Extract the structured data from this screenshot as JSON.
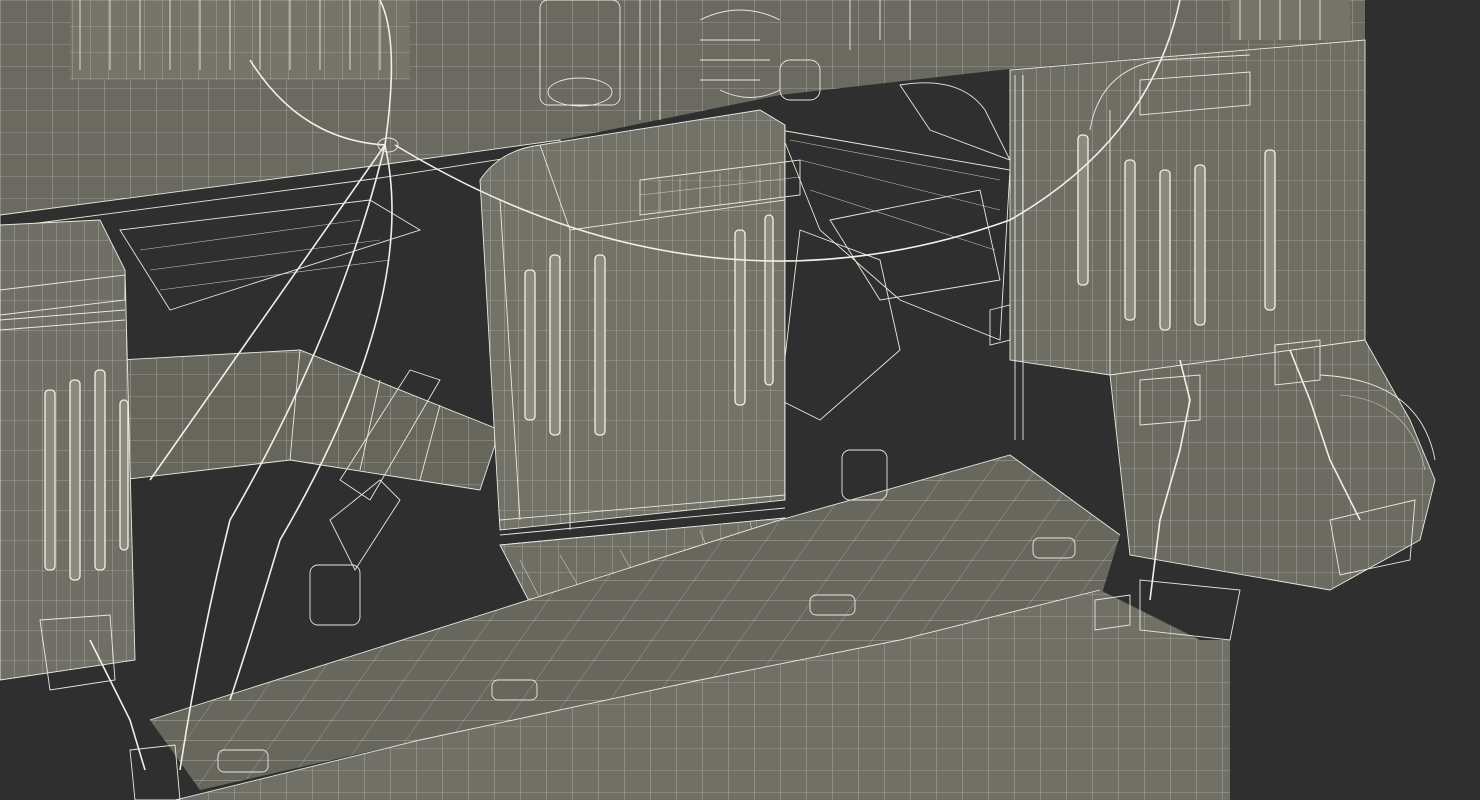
{
  "scene": {
    "subject": "semi-submersible-platform-wireframe",
    "colors": {
      "background": "#2f2f2f",
      "hull": "#6b6b62",
      "hull_shadow": "#55554d",
      "hull_light": "#7a7a70",
      "wire": "#e9e9df"
    }
  }
}
